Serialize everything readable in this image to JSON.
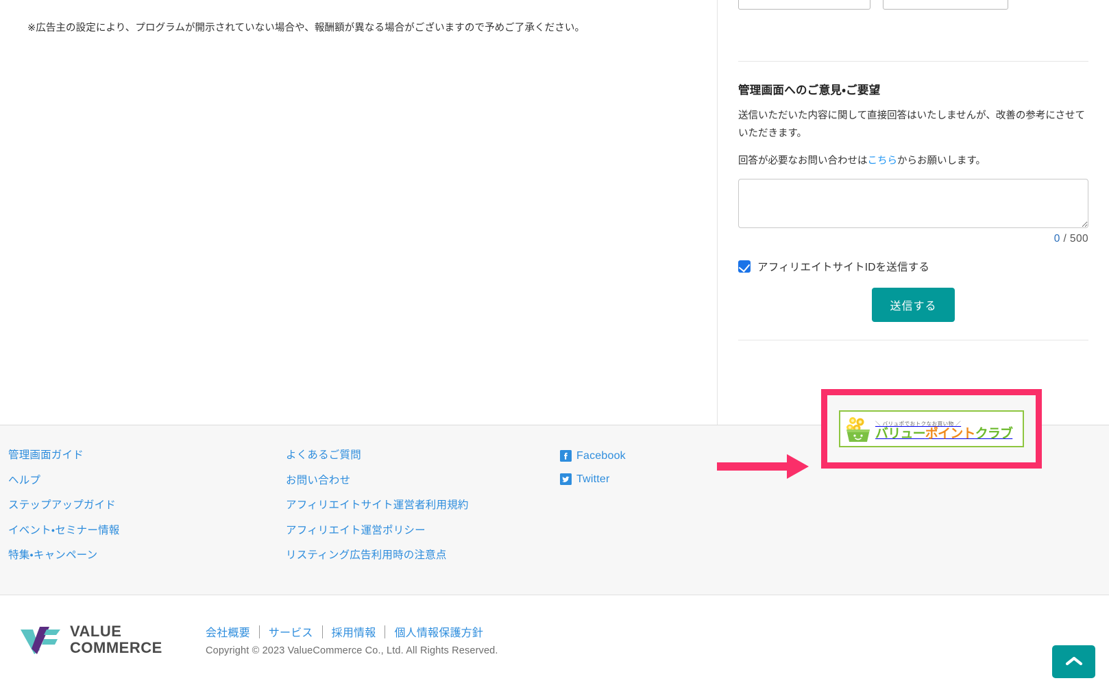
{
  "main": {
    "disclaimer": "※広告主の設定により、プログラムが開示されていない場合や、報酬額が異なる場合がございますので予めご了承ください。"
  },
  "sidebar": {
    "feedback": {
      "title": "管理画面へのご意見・ご要望",
      "paragraph1": "送信いただいた内容に関して直接回答はいたしませんが、改善の参考にさせていただきます。",
      "paragraph2_before": "回答が必要なお問い合わせは",
      "paragraph2_link": "こちら",
      "paragraph2_after": "からお願いします。",
      "textarea_value": "",
      "textarea_placeholder": "",
      "counter_current": "0",
      "counter_sep": "/ 500",
      "checkbox_label": "アフィリエイトサイトIDを送信する",
      "checkbox_checked": true,
      "submit_label": "送信する"
    }
  },
  "footer": {
    "column1": [
      {
        "label": "管理画面ガイド"
      },
      {
        "label": "ヘルプ"
      },
      {
        "label": "ステップアップガイド"
      },
      {
        "label": "イベント・セミナー情報"
      },
      {
        "label": "特集・キャンペーン"
      }
    ],
    "column2": [
      {
        "label": "よくあるご質問"
      },
      {
        "label": "お問い合わせ"
      },
      {
        "label": "アフィリエイトサイト運営者利用規約"
      },
      {
        "label": "アフィリエイト運営ポリシー"
      },
      {
        "label": "リスティング広告利用時の注意点"
      }
    ],
    "social": [
      {
        "label": "Facebook",
        "icon": "facebook-icon",
        "glyph": "f"
      },
      {
        "label": "Twitter",
        "icon": "twitter-icon",
        "glyph": "t"
      }
    ],
    "banner": {
      "tagline": "＼ バリュポでおトクなお買い物 ／",
      "name_part1": "バリュー",
      "name_part2": "ポイント",
      "name_part3": "クラブ",
      "icon": "shopping-basket-coins-icon",
      "highlight_color": "#fa2f69",
      "arrow_color": "#fa2f69",
      "border_color": "#8ec640"
    },
    "bottom": {
      "logo_line1": "VALUE",
      "logo_line2": "COMMERCE",
      "corporate_links": [
        {
          "label": "会社概要"
        },
        {
          "label": "サービス"
        },
        {
          "label": "採用情報"
        },
        {
          "label": "個人情報保護方針"
        }
      ],
      "copyright": "Copyright © 2023 ValueCommerce Co., Ltd. All Rights Reserved.",
      "to_top_icon": "chevron-up-icon"
    }
  },
  "colors": {
    "accent_teal": "#039999",
    "link_blue": "#2e8ddd",
    "highlight_pink": "#fa2f69",
    "checkbox_blue": "#1a73e8"
  }
}
